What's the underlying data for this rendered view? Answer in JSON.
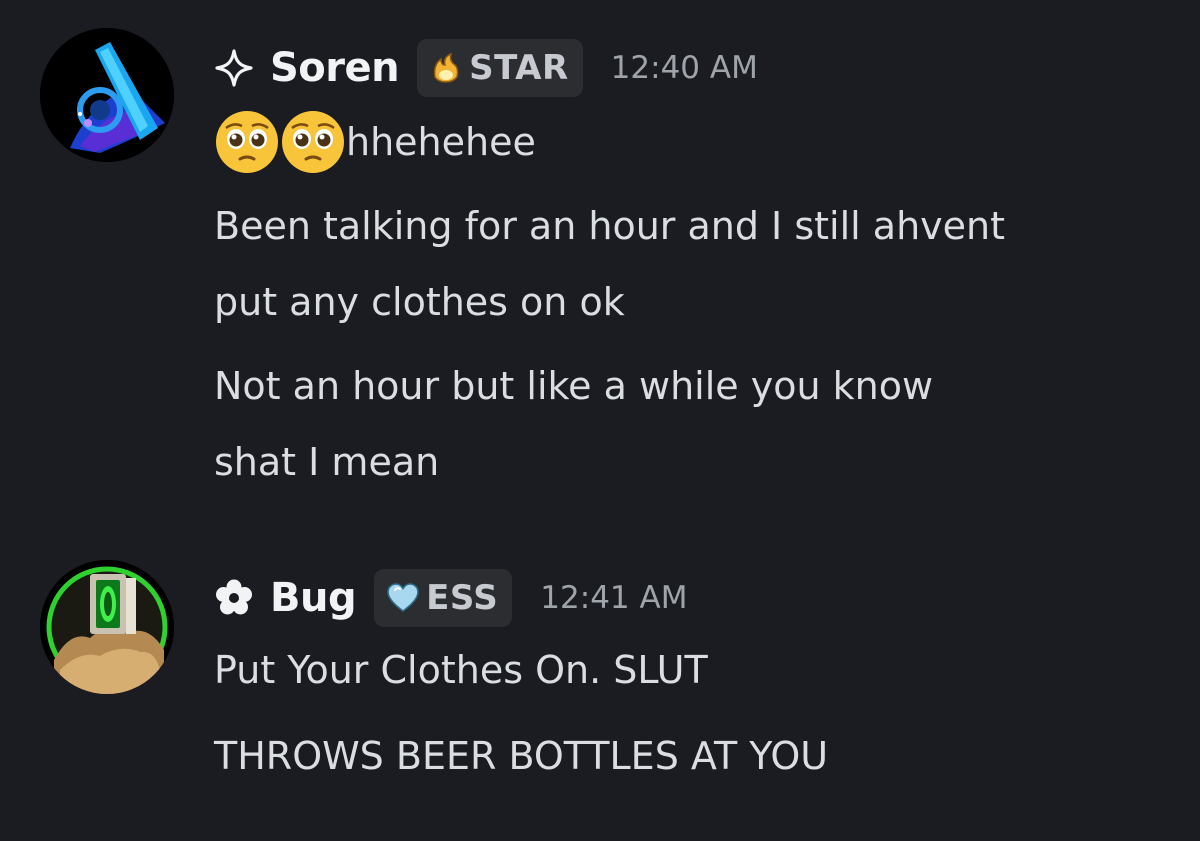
{
  "messages": [
    {
      "username": "Soren",
      "username_icon": "sparkle-icon",
      "badge": {
        "label": "STAR",
        "icon": "flame-icon"
      },
      "timestamp": "12:40 AM",
      "emoji": [
        "pleading-face-emoji",
        "pleading-face-emoji"
      ],
      "lines": [
        "hhehehee",
        "Been talking for an hour and I still ahvent",
        "put any clothes on ok",
        "Not an hour but like a while you know",
        "shat I mean"
      ]
    },
    {
      "username": "Bug",
      "username_icon": "flower-icon",
      "badge": {
        "label": "ESS",
        "icon": "heart-icon"
      },
      "timestamp": "12:41 AM",
      "lines": [
        "Put Your Clothes On. SLUT",
        "THROWS BEER BOTTLES AT YOU"
      ]
    }
  ],
  "colors": {
    "background": "#1b1c21",
    "text": "#dbdee1",
    "username": "#f2f3f5",
    "timestamp": "#9fa3aa",
    "badge_bg": "#2b2d31",
    "bug_avatar_ring": "#2fd12f"
  }
}
